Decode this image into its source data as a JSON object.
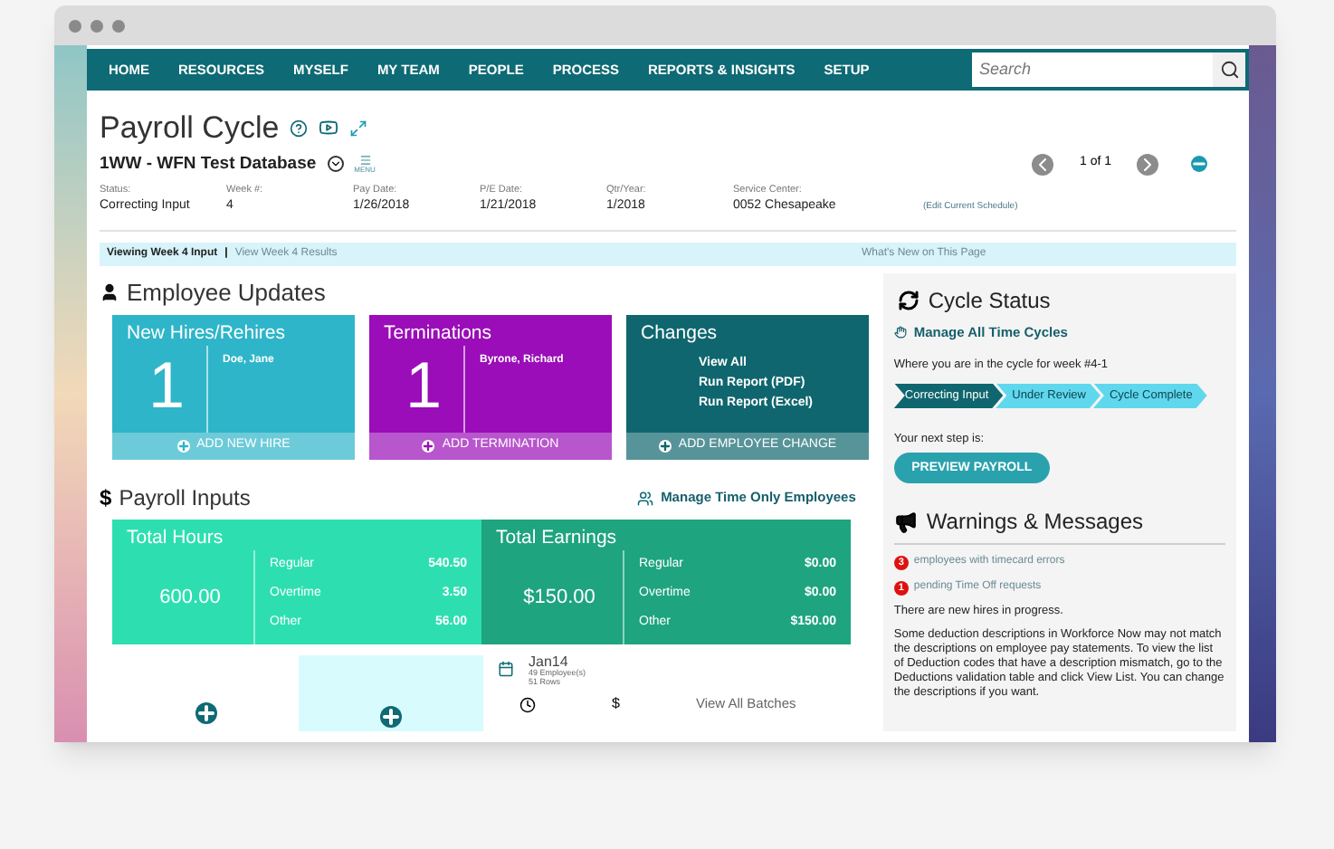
{
  "nav": {
    "items": [
      "HOME",
      "RESOURCES",
      "MYSELF",
      "MY TEAM",
      "PEOPLE",
      "PROCESS",
      "REPORTS & INSIGHTS",
      "SETUP"
    ],
    "search": {
      "placeholder": "Search"
    }
  },
  "header": {
    "title": "Payroll Cycle",
    "database": "1WW - WFN Test Database",
    "menu_label": "MENU",
    "pager": "1 of 1",
    "edit_link": "(Edit Current Schedule)",
    "fields": [
      {
        "label": "Status:",
        "value": "Correcting Input"
      },
      {
        "label": "Week #:",
        "value": "4"
      },
      {
        "label": "Pay Date:",
        "value": "1/26/2018"
      },
      {
        "label": "P/E Date:",
        "value": "1/21/2018"
      },
      {
        "label": "Qtr/Year:",
        "value": "1/2018"
      },
      {
        "label": "Service Center:",
        "value": "0052  Chesapeake"
      }
    ]
  },
  "viewing_bar": {
    "current": "Viewing Week 4 Input",
    "separator": "|",
    "link": "View Week 4 Results",
    "whats_new": "What's New on This Page"
  },
  "employee_updates": {
    "title": "Employee Updates",
    "cards": [
      {
        "kind": "count",
        "title": "New Hires/Rehires",
        "count": "1",
        "names": [
          "Doe, Jane"
        ],
        "action": "ADD NEW HIRE",
        "color": "#2eb5c9"
      },
      {
        "kind": "count",
        "title": "Terminations",
        "count": "1",
        "names": [
          "Byrone, Richard"
        ],
        "action": "ADD TERMINATION",
        "color": "#9a0db8"
      },
      {
        "kind": "links",
        "title": "Changes",
        "links": [
          "View All",
          "Run Report (PDF)",
          "Run Report (Excel)"
        ],
        "action": "ADD EMPLOYEE CHANGE",
        "color": "#0f666e"
      }
    ]
  },
  "payroll_inputs": {
    "title": "Payroll Inputs",
    "link": "Manage Time Only Employees",
    "totals": [
      {
        "title": "Total Hours",
        "total": "600.00",
        "color": "#2ddfb0",
        "rows": [
          {
            "label": "Regular",
            "value": "540.50"
          },
          {
            "label": "Overtime",
            "value": "3.50"
          },
          {
            "label": "Other",
            "value": "56.00"
          }
        ]
      },
      {
        "title": "Total Earnings",
        "total": "$150.00",
        "color": "#1ea47f",
        "rows": [
          {
            "label": "Regular",
            "value": "$0.00"
          },
          {
            "label": "Overtime",
            "value": "$0.00"
          },
          {
            "label": "Other",
            "value": "$150.00"
          }
        ]
      }
    ]
  },
  "batches": {
    "name": "Jan14",
    "employees": "49 Employee(s)",
    "rows": "51 Rows",
    "currency_symbol": "$",
    "view_all": "View All Batches"
  },
  "cycle_status": {
    "title": "Cycle Status",
    "manage_link": "Manage All Time Cycles",
    "where_text": "Where you are in the cycle for week #4-1",
    "steps": [
      {
        "label": "Correcting Input",
        "selected": true
      },
      {
        "label": "Under Review",
        "selected": false
      },
      {
        "label": "Cycle Complete",
        "selected": false
      }
    ],
    "next_label": "Your next step is:",
    "button": "PREVIEW PAYROLL"
  },
  "warnings": {
    "title": "Warnings & Messages",
    "alerts": [
      {
        "count": "3",
        "text": "employees with timecard errors"
      },
      {
        "count": "1",
        "text": "pending Time Off requests"
      }
    ],
    "messages": [
      "There are new hires in progress.",
      "Some deduction descriptions in Workforce Now may not match the descriptions on employee pay statements. To view the list of Deduction codes that have a description mismatch, go to the Deductions validation table and click View List. You can change the descriptions if you want."
    ]
  }
}
